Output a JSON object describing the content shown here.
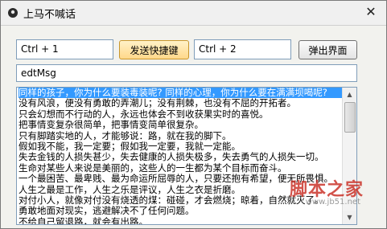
{
  "window": {
    "title": "上马不喊话",
    "close_glyph": "✕"
  },
  "hotkey1": {
    "value": "Ctrl + 1"
  },
  "send_hotkey_button": {
    "label": "发送快捷键"
  },
  "hotkey2": {
    "value": "Ctrl + 2"
  },
  "popup_button": {
    "label": "弹出界面"
  },
  "msg_edit": {
    "value": "edtMsg"
  },
  "content": {
    "lines": [
      "同样的孩子，你为什么要装毒装呢? 同样的心理，你为什么要在满满坝喝呢?",
      "没有风浪，便没有勇敢的弄潮儿；没有荆棘，也没有不屈的开拓者。",
      "只会幻想而不行动的人，永远也体会不到收获果实时的喜悦。",
      "把事情变复杂很简单，把事情变简单很复杂。",
      "只有脚踏实地的人，才能够说：路，就在我的脚下。",
      "假如我不能，我一定要；假如我一定要，我就一定能。",
      "失去金钱的人损失甚少，失去健康的人损失极多，失去勇气的人损失一切。",
      "生命对某些人来说是美丽的，这些人的一生都为某个目标而奋斗。",
      "一个最困苦、最卑贱、最为命运所屈辱的人，只要还抱有希望，便无所畏惧。",
      "人生之最是工作，人生之乐是评议，人生之衣是折磨。",
      "对付小人，就像对付没有烧透的煤：碰碰，才会燃烧；晾着，自然就灭了。",
      "勇敢地面对现实，逃避解决不了任何问题。",
      "不给自己留退路，就会有出路。"
    ]
  },
  "watermark": {
    "text": "脚本之家",
    "url": "www.jb51.net"
  },
  "colors": {
    "selection": "#3399ff",
    "hot_button": "#ffd88a",
    "watermark": "#c8281e"
  }
}
